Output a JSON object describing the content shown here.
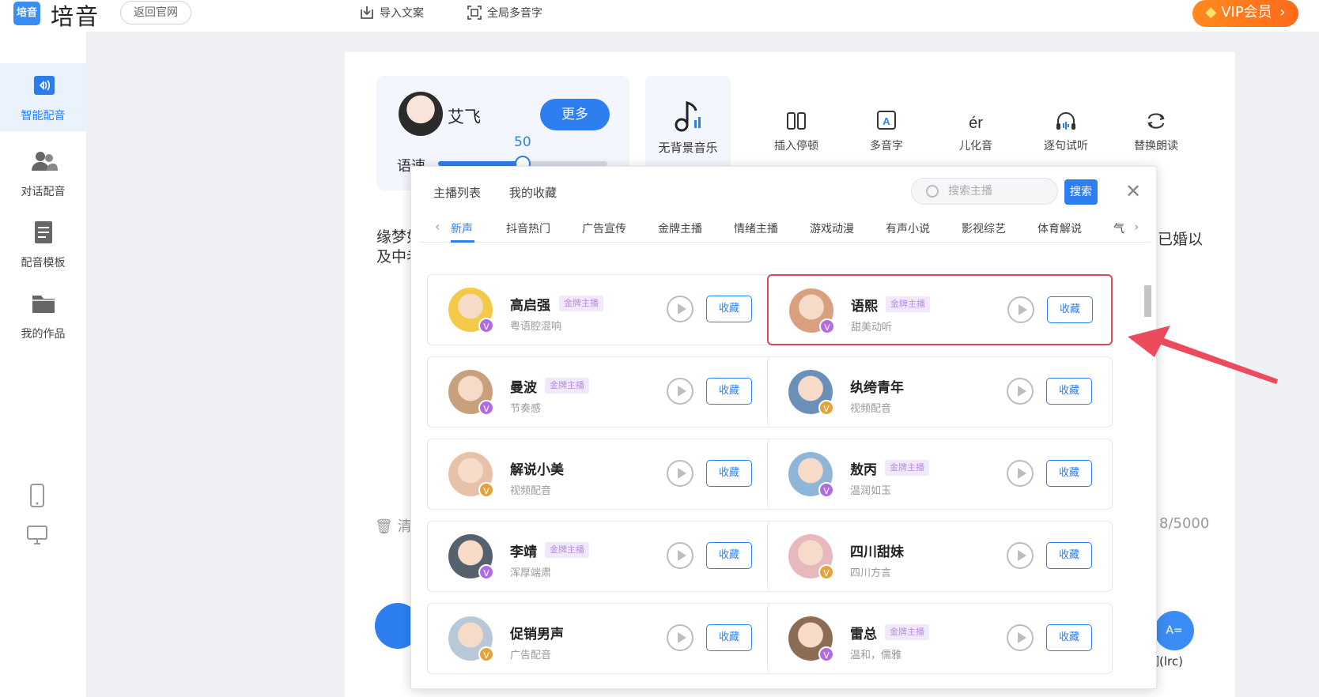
{
  "app": {
    "title": "培音",
    "logo": "培音",
    "back_label": "返回官网"
  },
  "top_actions": [
    {
      "label": "导入文案",
      "icon": "import-icon"
    },
    {
      "label": "全局多音字",
      "icon": "scan-icon"
    }
  ],
  "vip": {
    "label": "VIP会员",
    "arrow": "›"
  },
  "sidebar": {
    "items": [
      {
        "label": "智能配音",
        "icon": "voice-icon",
        "active": true
      },
      {
        "label": "对话配音",
        "icon": "dialog-icon"
      },
      {
        "label": "配音模板",
        "icon": "template-icon"
      },
      {
        "label": "我的作品",
        "icon": "folder-icon"
      }
    ],
    "devices": [
      "mobile-icon",
      "desktop-icon"
    ]
  },
  "voice": {
    "name": "艾飞",
    "more": "更多",
    "speed_label": "语速",
    "speed_value": "50",
    "speed_fraction": 0.5
  },
  "bgm": {
    "label": "无背景音乐"
  },
  "tools": [
    {
      "label": "插入停顿",
      "icon": "pause-icon"
    },
    {
      "label": "多音字",
      "icon": "polyphone-icon"
    },
    {
      "label": "儿化音",
      "icon": "er-icon"
    },
    {
      "label": "逐句试听",
      "icon": "headphone-icon"
    },
    {
      "label": "替换朗读",
      "icon": "replace-icon"
    }
  ],
  "editor": {
    "text_left_1": "缘梦如",
    "text_left_2": "及中老",
    "text_right": "已婚以",
    "clear_label": "清",
    "count": "8/5000",
    "lyric_icon": "A=",
    "lyric_label": "歌词(lrc)"
  },
  "popup": {
    "tabs": [
      "主播列表",
      "我的收藏"
    ],
    "search_placeholder": "搜索主播",
    "search_label": "搜索",
    "close": "✕",
    "categories": [
      "新声",
      "抖音热门",
      "广告宣传",
      "金牌主播",
      "情绪主播",
      "游戏动漫",
      "有声小说",
      "影视综艺",
      "体育解说",
      "气"
    ],
    "prev_arrow": "‹",
    "next_arrow": "›",
    "badge_label": "金牌主播",
    "play_label": "",
    "fav_label": "收藏",
    "voices": [
      {
        "name": "高启强",
        "desc": "粤语腔混响",
        "gold": true,
        "color": "#f3c94a"
      },
      {
        "name": "语熙",
        "desc": "甜美动听",
        "gold": true,
        "color": "#d9a07f",
        "highlight": true
      },
      {
        "name": "曼波",
        "desc": "节奏感",
        "gold": true,
        "color": "#c9a07c"
      },
      {
        "name": "纨绔青年",
        "desc": "视频配音",
        "gold": false,
        "color": "#6a90b8"
      },
      {
        "name": "解说小美",
        "desc": "视频配音",
        "gold": false,
        "color": "#e8c2a8"
      },
      {
        "name": "敖丙",
        "desc": "温润如玉",
        "gold": true,
        "color": "#8fb5d8"
      },
      {
        "name": "李靖",
        "desc": "浑厚端肃",
        "gold": true,
        "color": "#55626d"
      },
      {
        "name": "四川甜妹",
        "desc": "四川方言",
        "gold": false,
        "color": "#e7b8be"
      },
      {
        "name": "促销男声",
        "desc": "广告配音",
        "gold": false,
        "color": "#b9c8d8"
      },
      {
        "name": "雷总",
        "desc": "温和，儒雅",
        "gold": true,
        "color": "#8c6c55"
      }
    ]
  },
  "colors": {
    "accent": "#2d7ff0",
    "vip": "#ff7b1c",
    "highlight": "#d64b5a"
  }
}
